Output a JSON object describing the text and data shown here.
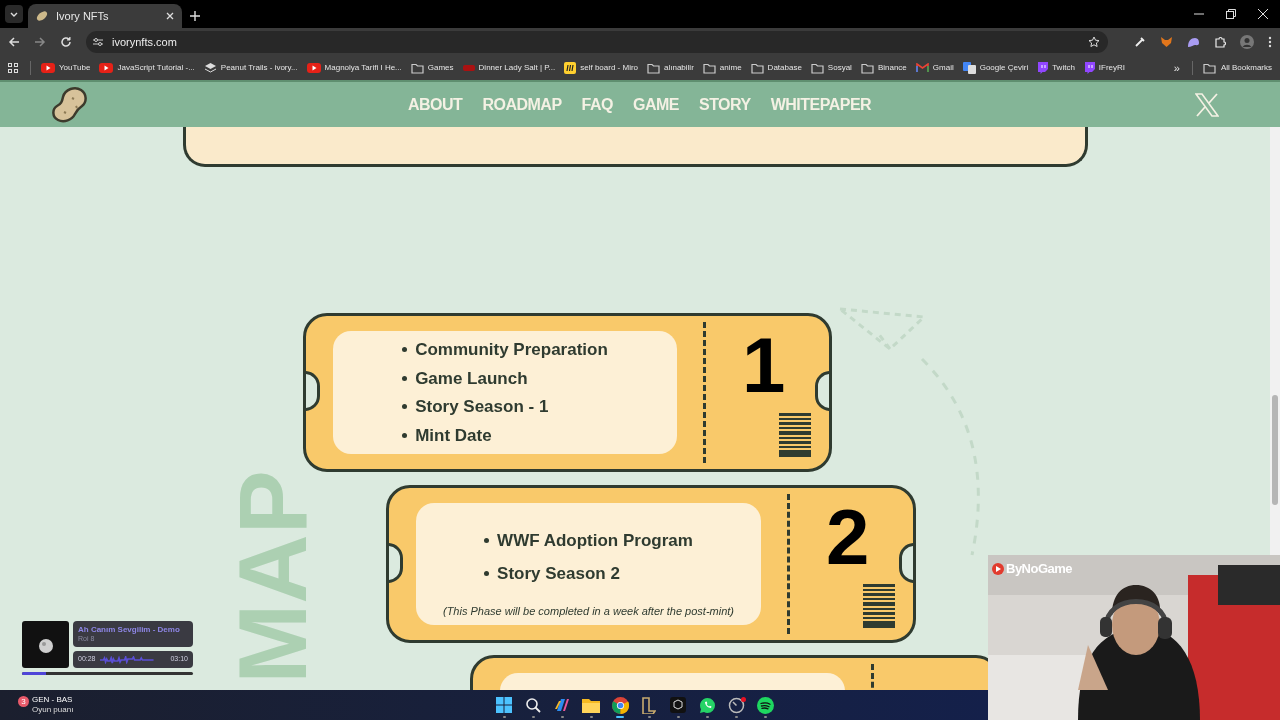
{
  "browser": {
    "tab": {
      "title": "Ivory NFTs",
      "selected": true
    },
    "address": "ivorynfts.com",
    "bookmarks": [
      {
        "label": "YouTube",
        "kind": "youtube"
      },
      {
        "label": "JavaScript Tutorial -...",
        "kind": "youtube"
      },
      {
        "label": "Peanut Trails - ivory...",
        "kind": "stack"
      },
      {
        "label": "Magnolya Tarifi I He...",
        "kind": "youtube"
      },
      {
        "label": "Games",
        "kind": "folder"
      },
      {
        "label": "Dinner Lady Salt | P...",
        "kind": "brand"
      },
      {
        "label": "self board - Miro",
        "kind": "miro"
      },
      {
        "label": "alınabilir",
        "kind": "folder"
      },
      {
        "label": "anime",
        "kind": "folder"
      },
      {
        "label": "Database",
        "kind": "folder"
      },
      {
        "label": "Sosyal",
        "kind": "folder"
      },
      {
        "label": "Binance",
        "kind": "folder"
      },
      {
        "label": "Gmail",
        "kind": "gmail"
      },
      {
        "label": "Google Çeviri",
        "kind": "translate"
      },
      {
        "label": "Twitch",
        "kind": "twitch"
      },
      {
        "label": "IFreyRI",
        "kind": "twitch"
      }
    ],
    "more": "»",
    "all_bookmarks": "All Bookmarks"
  },
  "site": {
    "nav": [
      {
        "label": "ABOUT"
      },
      {
        "label": "ROADMAP"
      },
      {
        "label": "FAQ"
      },
      {
        "label": "GAME"
      },
      {
        "label": "STORY"
      },
      {
        "label": "WHITEPAPER"
      }
    ]
  },
  "roadmap": {
    "heading": "MAP",
    "tickets": [
      {
        "kind": "full",
        "number": "1",
        "items": [
          "Community Preparation",
          "Game Launch",
          "Story Season - 1",
          "Mint Date"
        ]
      },
      {
        "kind": "full",
        "number": "2",
        "items": [
          "WWF Adoption Program",
          "Story Season 2"
        ],
        "note": "(This Phase will be completed in a week after the post-mint)"
      },
      {
        "kind": "blank"
      }
    ]
  },
  "music_player": {
    "title": "Ah Canım Sevgilim - Demo",
    "artist": "Roi 8",
    "elapsed": "00:28",
    "duration": "03:10",
    "level": 0.14
  },
  "webcam": {
    "kind": "picture",
    "brand": "ByNoGame"
  },
  "taskbar": {
    "notification": {
      "count": "3",
      "title": "GEN - BAS",
      "subtitle": "Oyun puanı"
    },
    "apps": [
      {
        "kind": "windows",
        "active": false
      },
      {
        "kind": "search",
        "active": false
      },
      {
        "kind": "copilot",
        "active": false
      },
      {
        "kind": "folder",
        "active": false
      },
      {
        "kind": "chrome",
        "active": true
      },
      {
        "kind": "league",
        "active": false
      },
      {
        "kind": "box",
        "active": false
      },
      {
        "kind": "whatsapp",
        "active": false
      },
      {
        "kind": "gauge",
        "active": false,
        "badge": true
      },
      {
        "kind": "spotify",
        "active": false
      }
    ]
  }
}
